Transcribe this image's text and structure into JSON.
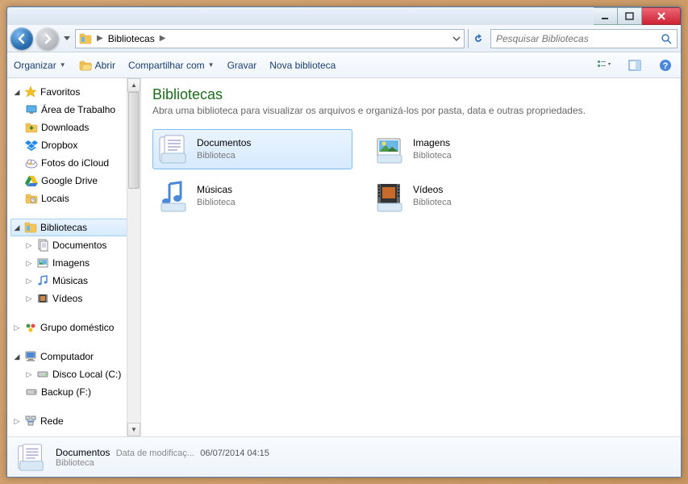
{
  "breadcrumb": {
    "root": "Bibliotecas"
  },
  "search": {
    "placeholder": "Pesquisar Bibliotecas"
  },
  "toolbar": {
    "organize": "Organizar",
    "open": "Abrir",
    "share": "Compartilhar com",
    "burn": "Gravar",
    "newlib": "Nova biblioteca"
  },
  "sidebar": {
    "favorites": {
      "label": "Favoritos",
      "items": [
        "Área de Trabalho",
        "Downloads",
        "Dropbox",
        "Fotos do iCloud",
        "Google Drive",
        "Locais"
      ]
    },
    "libraries": {
      "label": "Bibliotecas",
      "items": [
        "Documentos",
        "Imagens",
        "Músicas",
        "Vídeos"
      ]
    },
    "homegroup": {
      "label": "Grupo doméstico"
    },
    "computer": {
      "label": "Computador",
      "items": [
        "Disco Local (C:)",
        "Backup (F:)"
      ]
    },
    "network": {
      "label": "Rede"
    }
  },
  "content": {
    "title": "Bibliotecas",
    "subtitle": "Abra uma biblioteca para visualizar os arquivos e organizá-los por pasta, data e outras propriedades.",
    "type_label": "Biblioteca",
    "items": [
      {
        "name": "Documentos"
      },
      {
        "name": "Imagens"
      },
      {
        "name": "Músicas"
      },
      {
        "name": "Vídeos"
      }
    ]
  },
  "details": {
    "name": "Documentos",
    "type": "Biblioteca",
    "mod_label": "Data de modificaç...",
    "mod_value": "06/07/2014 04:15"
  }
}
